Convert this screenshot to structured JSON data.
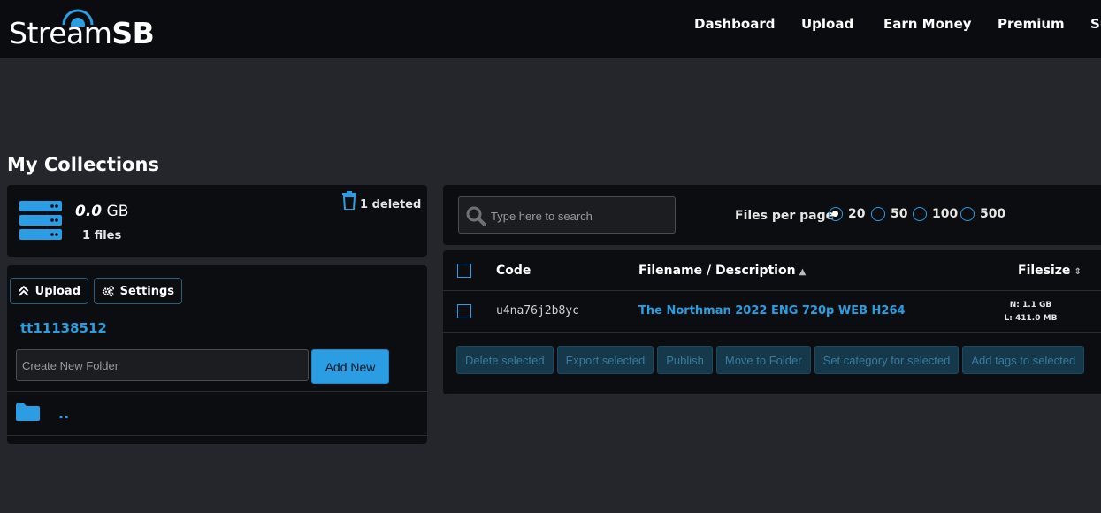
{
  "brand": {
    "logo_regular": "Stream",
    "logo_bold": "SB"
  },
  "nav": {
    "items": [
      "Dashboard",
      "Upload",
      "Earn Money",
      "Premium",
      "Su"
    ]
  },
  "page": {
    "title": "My Collections"
  },
  "storage": {
    "size_value": "0.0",
    "size_unit": "GB",
    "files": "1 files",
    "deleted": "1 deleted"
  },
  "folders": {
    "upload_label": "Upload",
    "settings_label": "Settings",
    "current_folder": "tt11138512",
    "new_folder_placeholder": "Create New Folder",
    "add_new_label": "Add New",
    "parent_link": ".."
  },
  "search": {
    "placeholder": "Type here to search"
  },
  "per_page": {
    "label": "Files per page",
    "options": [
      "20",
      "50",
      "100",
      "500"
    ],
    "selected": "20"
  },
  "table": {
    "headers": {
      "code": "Code",
      "filename": "Filename / Description",
      "filesize": "Filesize"
    },
    "rows": [
      {
        "code": "u4na76j2b8yc",
        "filename": "The Northman 2022 ENG 720p WEB H264",
        "size_n": "N: 1.1 GB",
        "size_l": "L: 411.0 MB"
      }
    ]
  },
  "actions": [
    "Delete selected",
    "Export selected",
    "Publish",
    "Move to Folder",
    "Set category for selected",
    "Add tags to selected"
  ],
  "colors": {
    "accent": "#2b9de3",
    "link": "#2a9fdf",
    "background": "#24262b",
    "card": "#0c0d11",
    "header": "#0b0c10"
  }
}
